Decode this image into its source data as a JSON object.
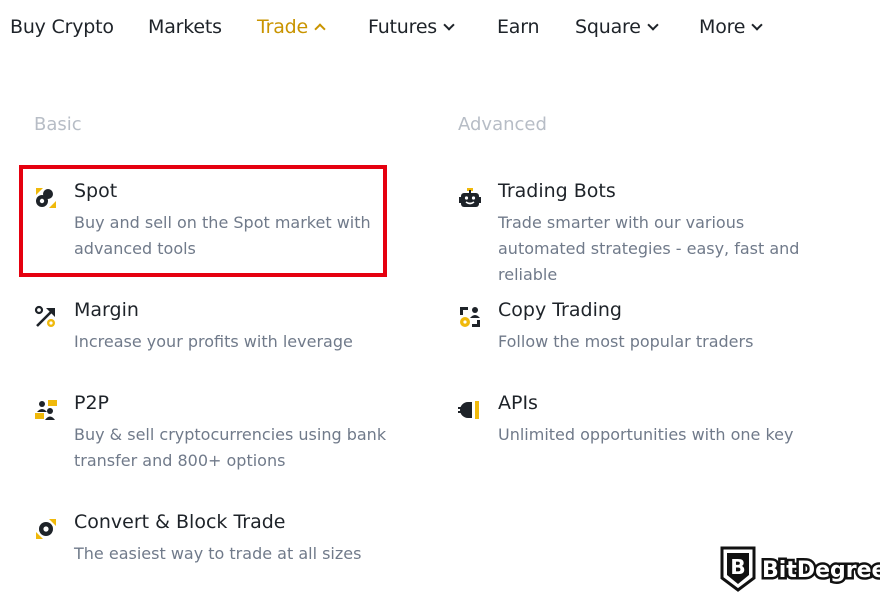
{
  "nav": {
    "items": [
      {
        "label": "Buy Crypto",
        "chevron": "none",
        "active": false
      },
      {
        "label": "Markets",
        "chevron": "none",
        "active": false
      },
      {
        "label": "Trade",
        "chevron": "up",
        "active": true
      },
      {
        "label": "Futures",
        "chevron": "down",
        "active": false
      },
      {
        "label": "Earn",
        "chevron": "none",
        "active": false
      },
      {
        "label": "Square",
        "chevron": "down",
        "active": false
      },
      {
        "label": "More",
        "chevron": "down",
        "active": false
      }
    ]
  },
  "menu": {
    "basic": {
      "title": "Basic",
      "items": [
        {
          "icon": "spot-icon",
          "title": "Spot",
          "desc": "Buy and sell on the Spot market with advanced tools",
          "highlighted": true
        },
        {
          "icon": "margin-icon",
          "title": "Margin",
          "desc": "Increase your profits with leverage"
        },
        {
          "icon": "p2p-icon",
          "title": "P2P",
          "desc": "Buy & sell cryptocurrencies using bank transfer and 800+ options"
        },
        {
          "icon": "convert-icon",
          "title": "Convert & Block Trade",
          "desc": "The easiest way to trade at all sizes"
        }
      ]
    },
    "advanced": {
      "title": "Advanced",
      "items": [
        {
          "icon": "robot-icon",
          "title": "Trading Bots",
          "desc": "Trade smarter with our various automated strategies - easy, fast and reliable"
        },
        {
          "icon": "copy-trading-icon",
          "title": "Copy Trading",
          "desc": "Follow the most popular traders"
        },
        {
          "icon": "api-icon",
          "title": "APIs",
          "desc": "Unlimited opportunities with one key"
        }
      ]
    }
  },
  "watermark": {
    "text": "BitDegree"
  },
  "colors": {
    "accent": "#c99400",
    "icon_yellow": "#f0b90b",
    "highlight_border": "#e5000f",
    "section_title": "#b7bdc6",
    "desc_text": "#707a8a"
  }
}
